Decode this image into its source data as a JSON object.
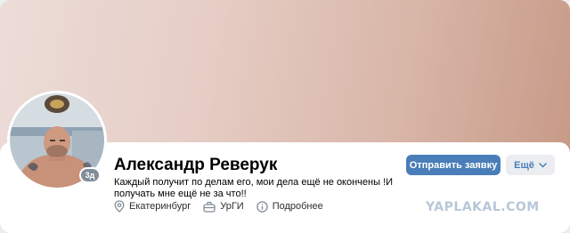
{
  "profile": {
    "name": "Александр Реверук",
    "status": "Каждый получит по делам его, мои дела ещё не окончены !И получать мне ещё не за что!!",
    "badge": "3д",
    "info": {
      "city": "Екатеринбург",
      "university": "УрГИ",
      "more": "Подробнее"
    }
  },
  "actions": {
    "send_request": "Отправить заявку",
    "more": "Ещё"
  },
  "watermark": "YAPLAKAL.COM",
  "colors": {
    "accent": "#4a7eb8",
    "secondary_button_bg": "#ebedf0"
  },
  "icons": {
    "city": "location-pin-icon",
    "university": "briefcase-icon",
    "more": "info-circle-icon",
    "dropdown": "chevron-down-icon"
  }
}
